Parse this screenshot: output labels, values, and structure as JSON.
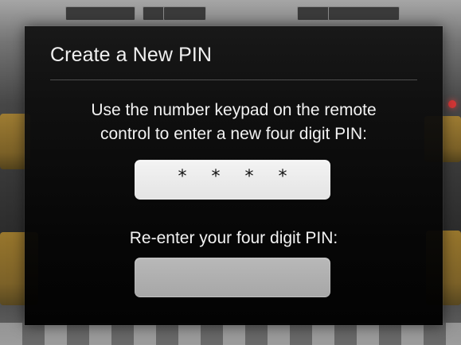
{
  "dialog": {
    "title": "Create a New PIN",
    "instruction_line_1": "Use the number keypad on the remote",
    "instruction_line_2": "control to enter a new four digit PIN:",
    "pin_value_mask": "* * * *",
    "reenter_label": "Re-enter your four digit PIN:",
    "reenter_value": ""
  },
  "colors": {
    "dialog_background": "#000000",
    "text_primary": "#f2f2f2",
    "field_active": "#e8e8e8",
    "field_inactive": "#b3b3b3"
  }
}
